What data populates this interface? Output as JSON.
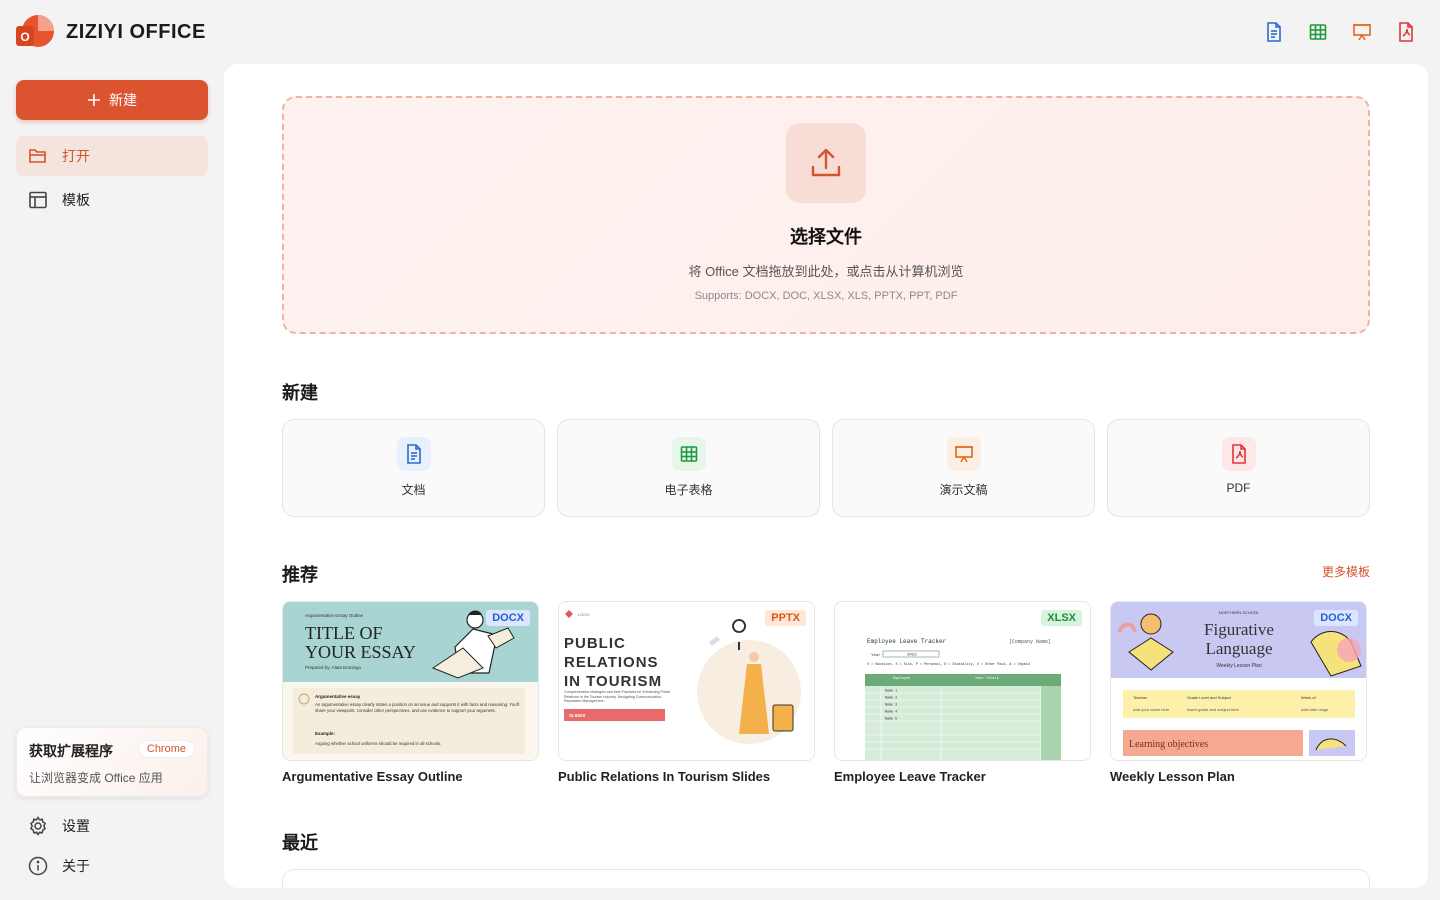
{
  "app": {
    "name": "ZIZIYI OFFICE",
    "logo_letter": "O"
  },
  "colors": {
    "accent": "#dc5330",
    "docx": "#2a6bd7",
    "xlsx": "#1f9a3c",
    "pptx": "#e06a20",
    "pdf": "#e0353a"
  },
  "top_icons": [
    "document-icon",
    "spreadsheet-icon",
    "presentation-icon",
    "pdf-icon"
  ],
  "sidebar": {
    "new_label": "新建",
    "items": [
      {
        "label": "打开",
        "icon": "folder-icon",
        "active": true
      },
      {
        "label": "模板",
        "icon": "template-icon",
        "active": false
      }
    ],
    "extension": {
      "title": "获取扩展程序",
      "subtitle": "让浏览器变成 Office 应用",
      "badge": "Chrome"
    },
    "bottom": [
      {
        "label": "设置",
        "icon": "gear-icon"
      },
      {
        "label": "关于",
        "icon": "info-icon"
      }
    ]
  },
  "dropzone": {
    "title": "选择文件",
    "description": "将 Office 文档拖放到此处，或点击从计算机浏览",
    "supports": "Supports: DOCX, DOC, XLSX, XLS, PPTX, PPT, PDF"
  },
  "new_section": {
    "title": "新建",
    "cards": [
      {
        "label": "文档",
        "icon": "document-icon"
      },
      {
        "label": "电子表格",
        "icon": "spreadsheet-icon"
      },
      {
        "label": "演示文稿",
        "icon": "presentation-icon"
      },
      {
        "label": "PDF",
        "icon": "pdf-icon"
      }
    ]
  },
  "recommended": {
    "title": "推荐",
    "more_link": "更多模板",
    "templates": [
      {
        "name": "Argumentative Essay Outline",
        "badge": "DOCX",
        "thumb": {
          "kicker": "Argumentative Essay Outline",
          "line1": "TITLE OF",
          "line2": "YOUR ESSAY",
          "byline": "Prepared by: Alaia Domingo",
          "box_title": "Argumentative essay",
          "box_text": "An argumentative essay clearly states a position on an issue and supports it with facts and reasoning. You'll share your viewpoint, consider other perspectives, and use evidence to support your argument.",
          "box_example": "Example:",
          "box_example_text": "Arguing whether school uniforms should be required in all schools."
        }
      },
      {
        "name": "Public Relations In Tourism Slides",
        "badge": "PPTX",
        "thumb": {
          "logo": "LOGO",
          "line1": "PUBLIC",
          "line2": "RELATIONS",
          "line3": "IN TOURISM",
          "tagline": "Comprehensive strategies and best Practices for Enhancing Public Relations in the Tourism Industry. Navigating Communication, Reputation Management...",
          "button": "SLIDES"
        }
      },
      {
        "name": "Employee Leave Tracker",
        "badge": "XLSX",
        "thumb": {
          "title": "Employee Leave Tracker",
          "company": "[Company Name]",
          "year_label": "Year",
          "year": "2023",
          "legend": "V = Vacation,  S = Sick,  P = Personal,  D = Disability,  U = Other Paid,  A = Unpaid",
          "col_employee": "Employee",
          "col_totals": "Year Totals",
          "rows": [
            "Name 1",
            "Name 2",
            "Name 3",
            "Name 4",
            "Name 5"
          ]
        }
      },
      {
        "name": "Weekly Lesson Plan",
        "badge": "DOCX",
        "thumb": {
          "school": "NORTHERN SCHOOL",
          "line1": "Figurative",
          "line2": "Language",
          "sub": "Weekly Lesson Plan",
          "c1": "Teacher",
          "c2": "Grade Level and Subject",
          "c3": "Week of",
          "v1": "Add your name here",
          "v2": "Insert grade and subject here",
          "v3": "Add date range",
          "objectives": "Learning objectives"
        }
      }
    ]
  },
  "recent": {
    "title": "最近"
  }
}
